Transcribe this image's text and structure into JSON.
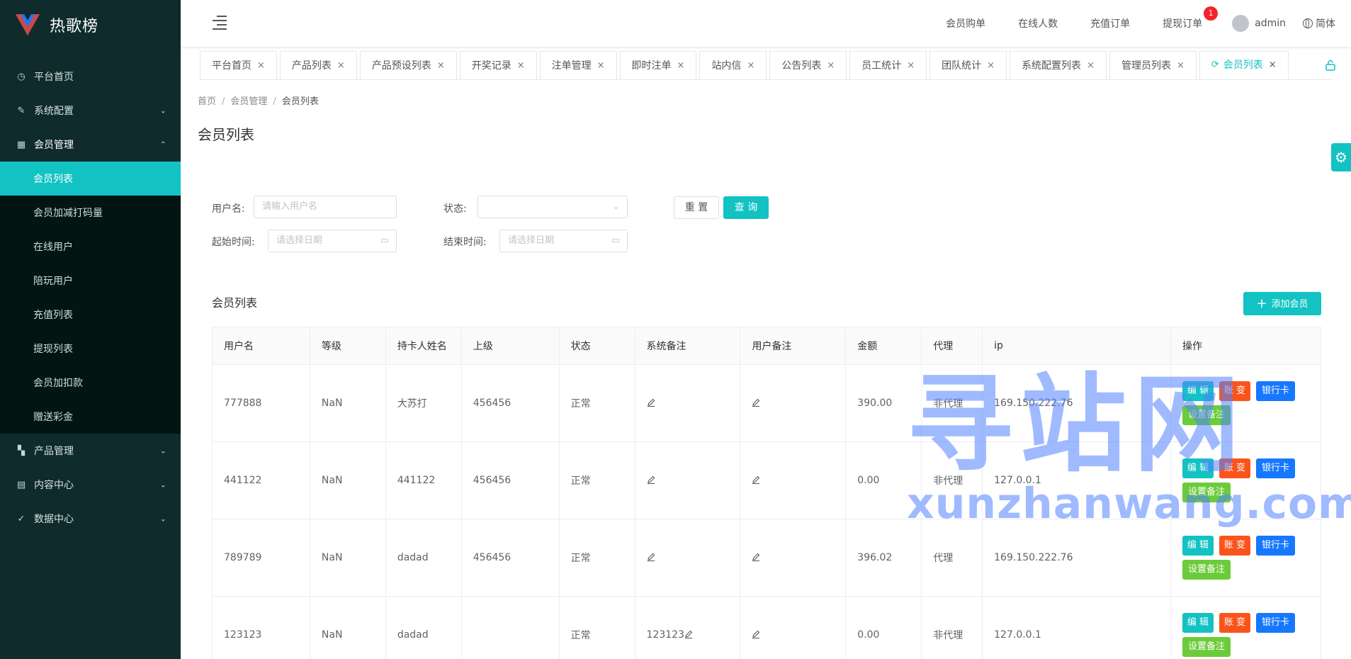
{
  "app": {
    "name": "热歌榜"
  },
  "sidebar": {
    "items": [
      {
        "label": "平台首页",
        "icon": "dashboard-icon"
      },
      {
        "label": "系统配置",
        "icon": "edit-icon",
        "arrow": "chevron-down-icon"
      },
      {
        "label": "会员管理",
        "icon": "table-icon",
        "arrow": "chevron-up-icon"
      },
      {
        "label": "产品管理",
        "icon": "grid-icon",
        "arrow": "chevron-down-icon"
      },
      {
        "label": "内容中心",
        "icon": "document-icon",
        "arrow": "chevron-down-icon"
      },
      {
        "label": "数据中心",
        "icon": "check-circle-icon",
        "arrow": "chevron-down-icon"
      }
    ],
    "submenu": [
      "会员列表",
      "会员加减打码量",
      "在线用户",
      "陪玩用户",
      "充值列表",
      "提现列表",
      "会员加扣款",
      "赠送彩金"
    ]
  },
  "topbar": {
    "links": [
      "会员购单",
      "在线人数",
      "充值订单",
      "提现订单"
    ],
    "badge": "1",
    "user": "admin",
    "lang": "简体"
  },
  "tabs": [
    "平台首页",
    "产品列表",
    "产品预设列表",
    "开奖记录",
    "注单管理",
    "即时注单",
    "站内信",
    "公告列表",
    "员工统计",
    "团队统计",
    "系统配置列表",
    "管理员列表",
    "会员列表"
  ],
  "breadcrumb": [
    "首页",
    "会员管理",
    "会员列表"
  ],
  "page_title": "会员列表",
  "filters": {
    "username_label": "用户名:",
    "username_placeholder": "请输入用户名",
    "status_label": "状态:",
    "start_label": "起始时间:",
    "start_placeholder": "请选择日期",
    "end_label": "结束时间:",
    "end_placeholder": "请选择日期",
    "reset": "重 置",
    "query": "查 询"
  },
  "list": {
    "title": "会员列表",
    "add_button": "添加会员",
    "columns": [
      "用户名",
      "等级",
      "持卡人姓名",
      "上级",
      "状态",
      "系统备注",
      "用户备注",
      "金额",
      "代理",
      "ip",
      "操作"
    ],
    "rows": [
      {
        "username": "777888",
        "level": "NaN",
        "holder": "大苏打",
        "parent": "456456",
        "status": "正常",
        "sys_note": "",
        "user_note": "",
        "amount": "390.00",
        "agent": "非代理",
        "ip": "169.150.222.76"
      },
      {
        "username": "441122",
        "level": "NaN",
        "holder": "441122",
        "parent": "456456",
        "status": "正常",
        "sys_note": "",
        "user_note": "",
        "amount": "0.00",
        "agent": "非代理",
        "ip": "127.0.0.1"
      },
      {
        "username": "789789",
        "level": "NaN",
        "holder": "dadad",
        "parent": "456456",
        "status": "正常",
        "sys_note": "",
        "user_note": "",
        "amount": "396.02",
        "agent": "代理",
        "ip": "169.150.222.76"
      },
      {
        "username": "123123",
        "level": "NaN",
        "holder": "dadad",
        "parent": "",
        "status": "正常",
        "sys_note": "123123",
        "user_note": "",
        "amount": "0.00",
        "agent": "非代理",
        "ip": "127.0.0.1"
      }
    ],
    "ops": {
      "edit": "编 辑",
      "account": "账 变",
      "bank": "银行卡",
      "note": "设置备注"
    }
  },
  "watermark": {
    "cn": "寻站网",
    "en": "xunzhanwang.com"
  },
  "colors": {
    "accent": "#13c2c2",
    "sidebar": "#0f2b2b",
    "orange": "#fa541c",
    "blue": "#1677ff",
    "green": "#52c41a"
  }
}
